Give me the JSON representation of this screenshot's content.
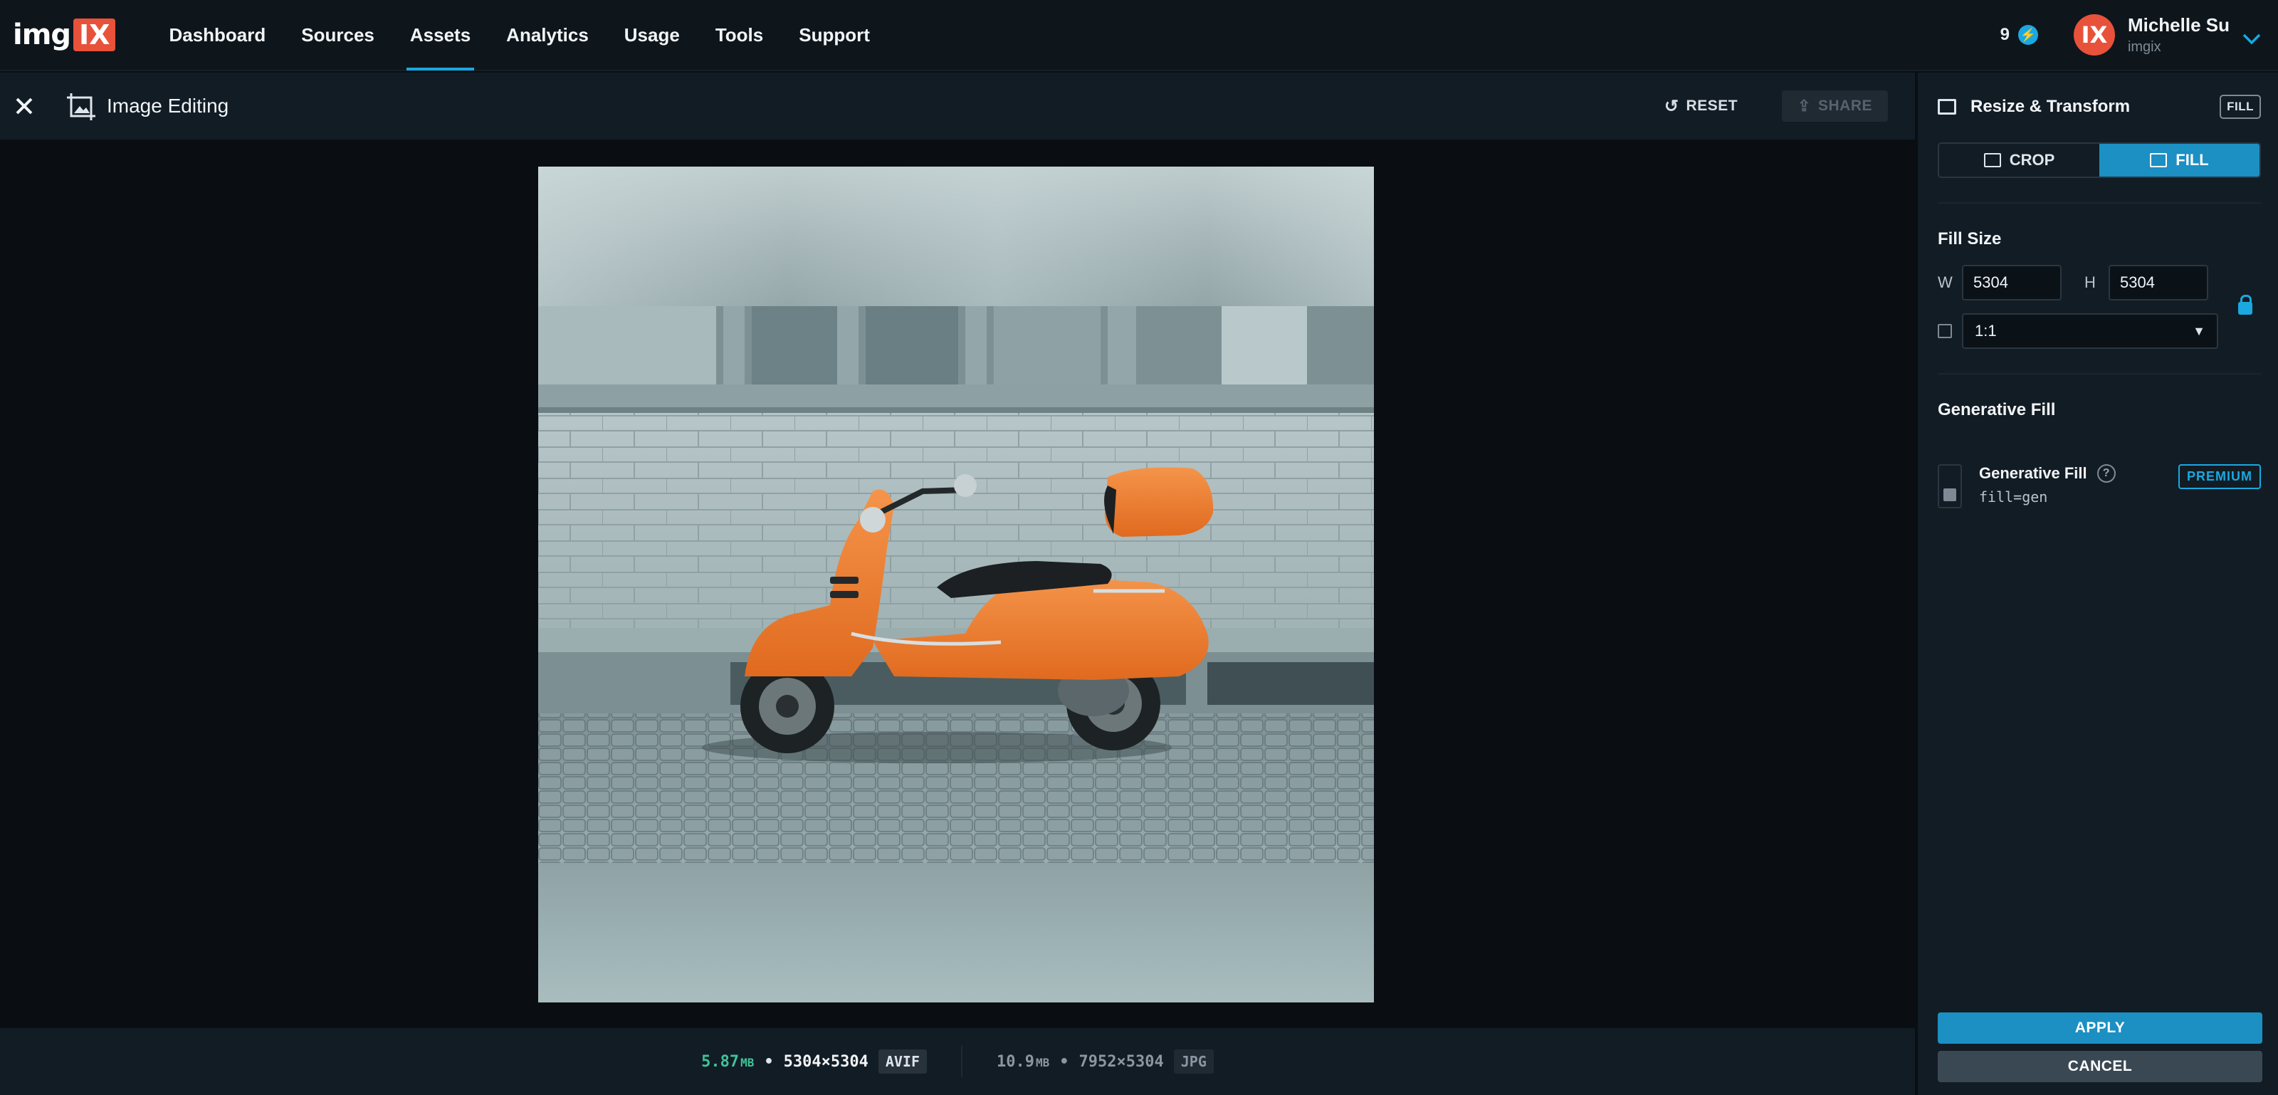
{
  "brand": {
    "logo_text": "img",
    "logo_mark": "IX",
    "accent": "#1ba8e0",
    "brand_color": "#e8523a"
  },
  "nav": {
    "items": [
      {
        "label": "Dashboard"
      },
      {
        "label": "Sources"
      },
      {
        "label": "Assets",
        "active": true
      },
      {
        "label": "Analytics"
      },
      {
        "label": "Usage"
      },
      {
        "label": "Tools"
      },
      {
        "label": "Support"
      }
    ]
  },
  "account": {
    "credits": "9",
    "credits_icon": "bolt-icon",
    "avatar_initials": "IX",
    "name": "Michelle Su",
    "org": "imgix"
  },
  "editor": {
    "title": "Image Editing",
    "close_icon": "close-icon",
    "reset_label": "RESET",
    "share_label": "SHARE"
  },
  "status": {
    "new_size": "5.87",
    "new_size_unit": "MB",
    "new_dims": "5304×5304",
    "new_format": "AVIF",
    "old_size": "10.9",
    "old_size_unit": "MB",
    "old_dims": "7952×5304",
    "old_format": "JPG",
    "separator": "•"
  },
  "panel": {
    "title": "Resize & Transform",
    "badge": "FILL",
    "tabs": [
      {
        "label": "CROP",
        "active": false
      },
      {
        "label": "FILL",
        "active": true
      }
    ],
    "fill_size": {
      "title": "Fill Size",
      "w_label": "W",
      "w_value": "5304",
      "h_label": "H",
      "h_value": "5304",
      "ratio": "1:1"
    },
    "generative": {
      "section_title": "Generative Fill",
      "item_name": "Generative Fill",
      "item_param": "fill=gen",
      "help": "?",
      "badge": "PREMIUM"
    },
    "apply_label": "APPLY",
    "cancel_label": "CANCEL"
  }
}
